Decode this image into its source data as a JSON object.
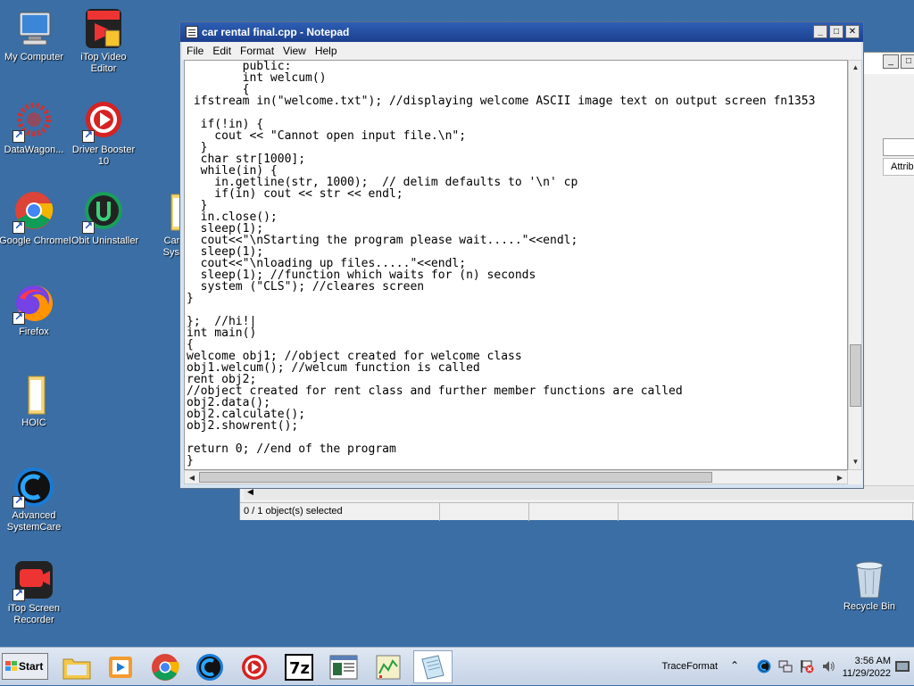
{
  "desktop": {
    "icons": [
      {
        "label": "My Computer"
      },
      {
        "label": "iTop Video Editor"
      },
      {
        "label": "DataWagon..."
      },
      {
        "label": "Driver Booster 10"
      },
      {
        "label": "Google Chrome"
      },
      {
        "label": "IObit Uninstaller"
      },
      {
        "label": "Car Re System"
      },
      {
        "label": "Firefox"
      },
      {
        "label": "HOIC"
      },
      {
        "label": "Advanced SystemCare"
      },
      {
        "label": "iTop Screen Recorder"
      },
      {
        "label": "Recycle Bin"
      }
    ]
  },
  "explorer": {
    "attributes_header": "Attributes",
    "status_selected": "0 / 1 object(s) selected"
  },
  "notepad": {
    "title": "car rental final.cpp - Notepad",
    "menu": [
      "File",
      "Edit",
      "Format",
      "View",
      "Help"
    ],
    "content": "        public:\n        int welcum()\n        {\n ifstream in(\"welcome.txt\"); //displaying welcome ASCII image text on output screen fn1353\n\n  if(!in) {\n    cout << \"Cannot open input file.\\n\";\n  }\n  char str[1000];\n  while(in) {\n    in.getline(str, 1000);  // delim defaults to '\\n' cp\n    if(in) cout << str << endl;\n  }\n  in.close();\n  sleep(1);\n  cout<<\"\\nStarting the program please wait.....\"<<endl;\n  sleep(1);\n  cout<<\"\\nloading up files.....\"<<endl;\n  sleep(1); //function which waits for (n) seconds\n  system (\"CLS\"); //cleares screen\n}\n\n};  //hi!|\nint main()\n{\nwelcome obj1; //object created for welcome class\nobj1.welcum(); //welcum function is called\nrent obj2;\n//object created for rent class and further member functions are called\nobj2.data();\nobj2.calculate();\nobj2.showrent();\n\nreturn 0; //end of the program\n}"
  },
  "taskbar": {
    "start_label": "Start",
    "tray_text": "TraceFormat",
    "clock_time": "3:56 AM",
    "clock_date": "11/29/2022"
  }
}
